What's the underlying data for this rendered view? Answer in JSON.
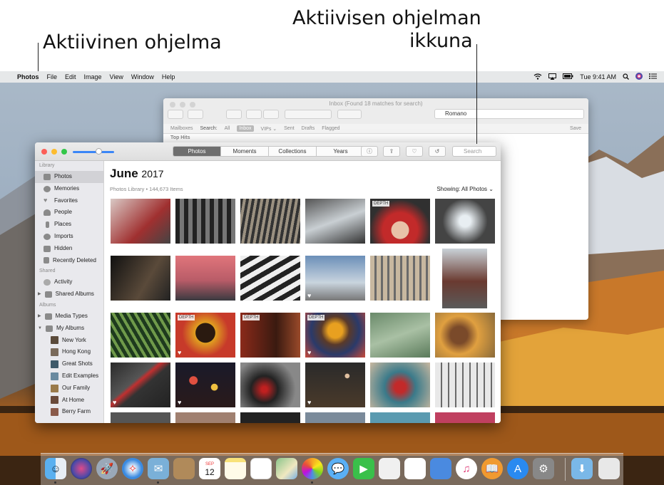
{
  "callouts": {
    "active_app": "Aktiivinen ohjelma",
    "active_window_line1": "Aktiivisen ohjelman",
    "active_window_line2": "ikkuna"
  },
  "menubar": {
    "apple_icon": "apple-icon",
    "app_name": "Photos",
    "menus": [
      "File",
      "Edit",
      "Image",
      "View",
      "Window",
      "Help"
    ],
    "status_icons": [
      "wifi-icon",
      "airplay-icon",
      "battery-icon"
    ],
    "clock": "Tue 9:41 AM",
    "right_icons": [
      "spotlight-icon",
      "siri-icon",
      "notification-center-icon"
    ]
  },
  "mail": {
    "title": "Inbox (Found 18 matches for search)",
    "search_value": "Romano",
    "favbar": {
      "mailboxes": "Mailboxes",
      "search_label": "Search:",
      "scopes": [
        "All",
        "Inbox",
        "VIPs ⌄",
        "Sent",
        "Drafts",
        "Flagged"
      ],
      "save": "Save"
    },
    "top_hits": "Top Hits"
  },
  "photos": {
    "tabs": [
      "Photos",
      "Moments",
      "Collections",
      "Years"
    ],
    "active_tab": "Photos",
    "search_placeholder": "Search",
    "sidebar": {
      "library_header": "Library",
      "library": [
        "Photos",
        "Memories",
        "Favorites",
        "People",
        "Places",
        "Imports",
        "Hidden",
        "Recently Deleted"
      ],
      "shared_header": "Shared",
      "shared": [
        "Activity",
        "Shared Albums"
      ],
      "albums_header": "Albums",
      "albums": [
        "Media Types",
        "My Albums"
      ],
      "my_albums": [
        "New York",
        "Hong Kong",
        "Great Shots",
        "Edit Examples",
        "Our Family",
        "At Home",
        "Berry Farm"
      ]
    },
    "month": "June",
    "year": "2017",
    "library_info": "Photos Library • 144,673 Items",
    "showing": "Showing: All Photos",
    "depth_label": "DEPTH"
  },
  "dock": {
    "apps": [
      "Finder",
      "Siri",
      "Launchpad",
      "Safari",
      "Mail",
      "Contacts",
      "Calendar",
      "Notes",
      "Reminders",
      "Maps",
      "Photos",
      "Messages",
      "FaceTime",
      "Pages",
      "Numbers",
      "Keynote",
      "iTunes",
      "iBooks",
      "App Store",
      "System Preferences",
      "Downloads",
      "Trash"
    ],
    "calendar_month": "SEP",
    "calendar_day": "12"
  },
  "colors": {
    "accent": "#3a86f7",
    "close": "#fc5f57",
    "minimize": "#fdbc2e",
    "zoom": "#33c748"
  }
}
